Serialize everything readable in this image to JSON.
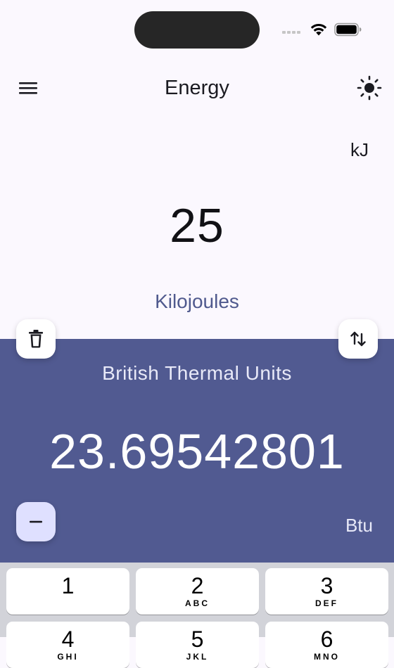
{
  "status_bar": {
    "wifi_icon": "wifi-icon",
    "battery_icon": "battery-icon"
  },
  "app_bar": {
    "title": "Energy",
    "menu_icon": "menu-icon",
    "theme_icon": "brightness-icon"
  },
  "input": {
    "symbol": "kJ",
    "value": "25",
    "unit_name": "Kilojoules"
  },
  "output": {
    "unit_name": "British Thermal Units",
    "value": "23.69542801",
    "symbol": "Btu"
  },
  "actions": {
    "delete_icon": "trash-icon",
    "swap_icon": "swap-vertical-icon",
    "negate_icon": "minus-icon"
  },
  "keypad": {
    "keys": [
      {
        "digit": "1",
        "letters": ""
      },
      {
        "digit": "2",
        "letters": "ABC"
      },
      {
        "digit": "3",
        "letters": "DEF"
      },
      {
        "digit": "4",
        "letters": "GHI"
      },
      {
        "digit": "5",
        "letters": "JKL"
      },
      {
        "digit": "6",
        "letters": "MNO"
      }
    ]
  },
  "colors": {
    "background": "#fbf8fe",
    "accent_panel": "#515a91",
    "accent_text": "#505a8e",
    "negate_button": "#dfe0ff",
    "keypad_background": "#d2d3d9"
  }
}
